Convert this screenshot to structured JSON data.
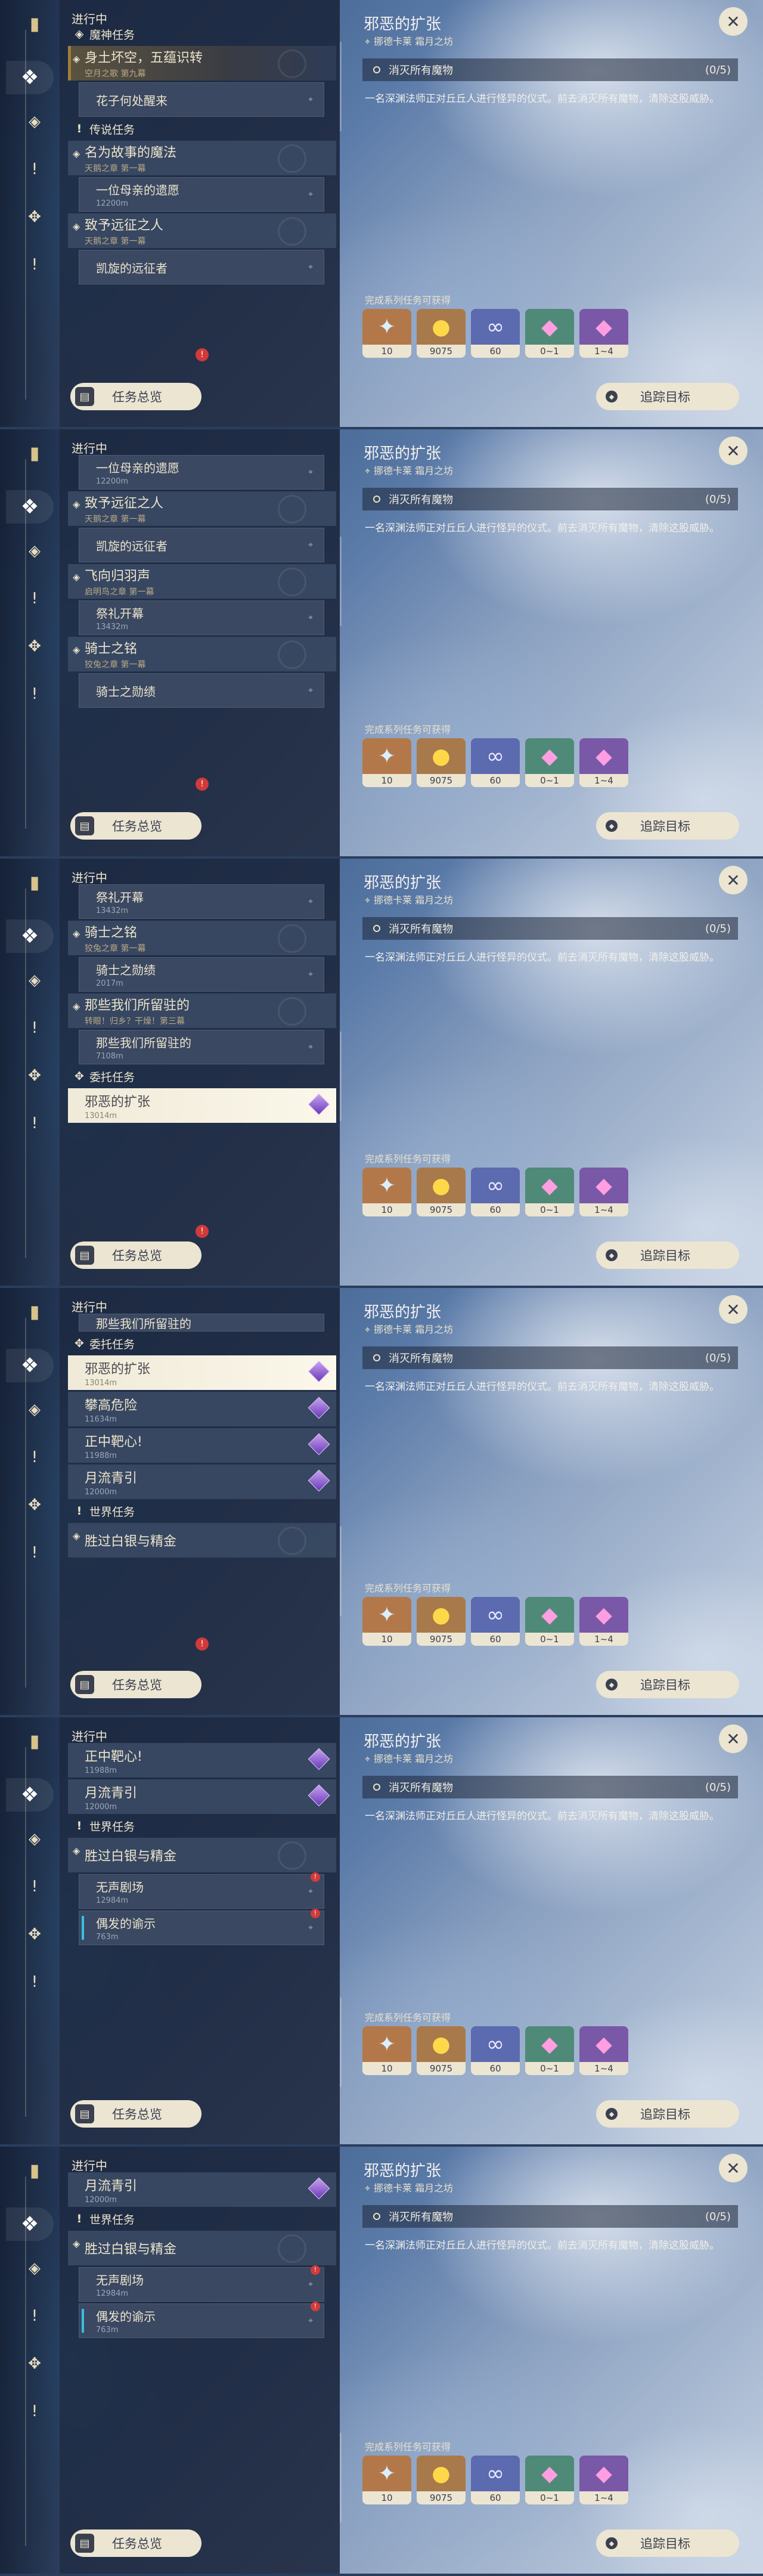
{
  "ui": {
    "in_progress": "进行中",
    "overview_label": "任务总览",
    "track_label": "追踪目标",
    "close_glyph": "✕",
    "rewards_label": "完成系列任务可获得",
    "alert_glyph": "!"
  },
  "detail": {
    "title": "邪恶的扩张",
    "location": "挪德卡莱 霜月之坊",
    "objective": "消灭所有魔物",
    "objective_count": "(0/5)",
    "description": "一名深渊法师正对丘丘人进行怪异的仪式。前去消灭所有魔物，清除这股威胁。",
    "rewards": [
      {
        "icon": "adventure-exp-icon",
        "glyph": "✦",
        "count": "10"
      },
      {
        "icon": "mora-icon",
        "glyph": "●",
        "count": "9075"
      },
      {
        "icon": "companionship-exp-icon",
        "glyph": "∞",
        "count": "60"
      },
      {
        "icon": "green-crystal-icon",
        "glyph": "◆",
        "count": "0~1"
      },
      {
        "icon": "pink-crystal-icon",
        "glyph": "◆",
        "count": "1~4"
      }
    ]
  },
  "categories": {
    "archon": "魔神任务",
    "story": "传说任务",
    "commission": "委托任务",
    "world": "世界任务"
  },
  "quests": {
    "q1": {
      "title": "身土坏空，五蕴识转",
      "sub": "空月之歌 第九幕"
    },
    "q2": {
      "title": "花子何处醒来"
    },
    "q3": {
      "title": "名为故事的魔法",
      "sub": "天鹅之章 第一幕"
    },
    "q4": {
      "title": "一位母亲的遗愿",
      "dist": "12200m"
    },
    "q5": {
      "title": "致予远征之人",
      "sub": "天鹅之章 第一幕"
    },
    "q6": {
      "title": "凯旋的远征者"
    },
    "q7": {
      "title": "飞向归羽声",
      "sub": "启明鸟之章 第一幕"
    },
    "q8": {
      "title": "祭礼开幕",
      "dist": "13432m"
    },
    "q9": {
      "title": "骑士之铭",
      "sub": "狡兔之章 第一幕"
    },
    "q10": {
      "title": "骑士之勋绩",
      "dist": "2017m"
    },
    "q11": {
      "title": "那些我们所留驻的",
      "sub": "转眼！归乡？干燥！第三幕"
    },
    "q12": {
      "title": "那些我们所留驻的",
      "dist": "7108m"
    },
    "q13": {
      "title": "邪恶的扩张",
      "dist": "13014m"
    },
    "q14": {
      "title": "攀高危险",
      "dist": "11634m"
    },
    "q15": {
      "title": "正中靶心!",
      "dist": "11988m"
    },
    "q16": {
      "title": "月流青引",
      "dist": "12000m"
    },
    "q17": {
      "title": "胜过白银与精金"
    },
    "q18": {
      "title": "无声剧场",
      "dist": "12984m"
    },
    "q19": {
      "title": "偶发的谕示",
      "dist": "763m"
    }
  }
}
